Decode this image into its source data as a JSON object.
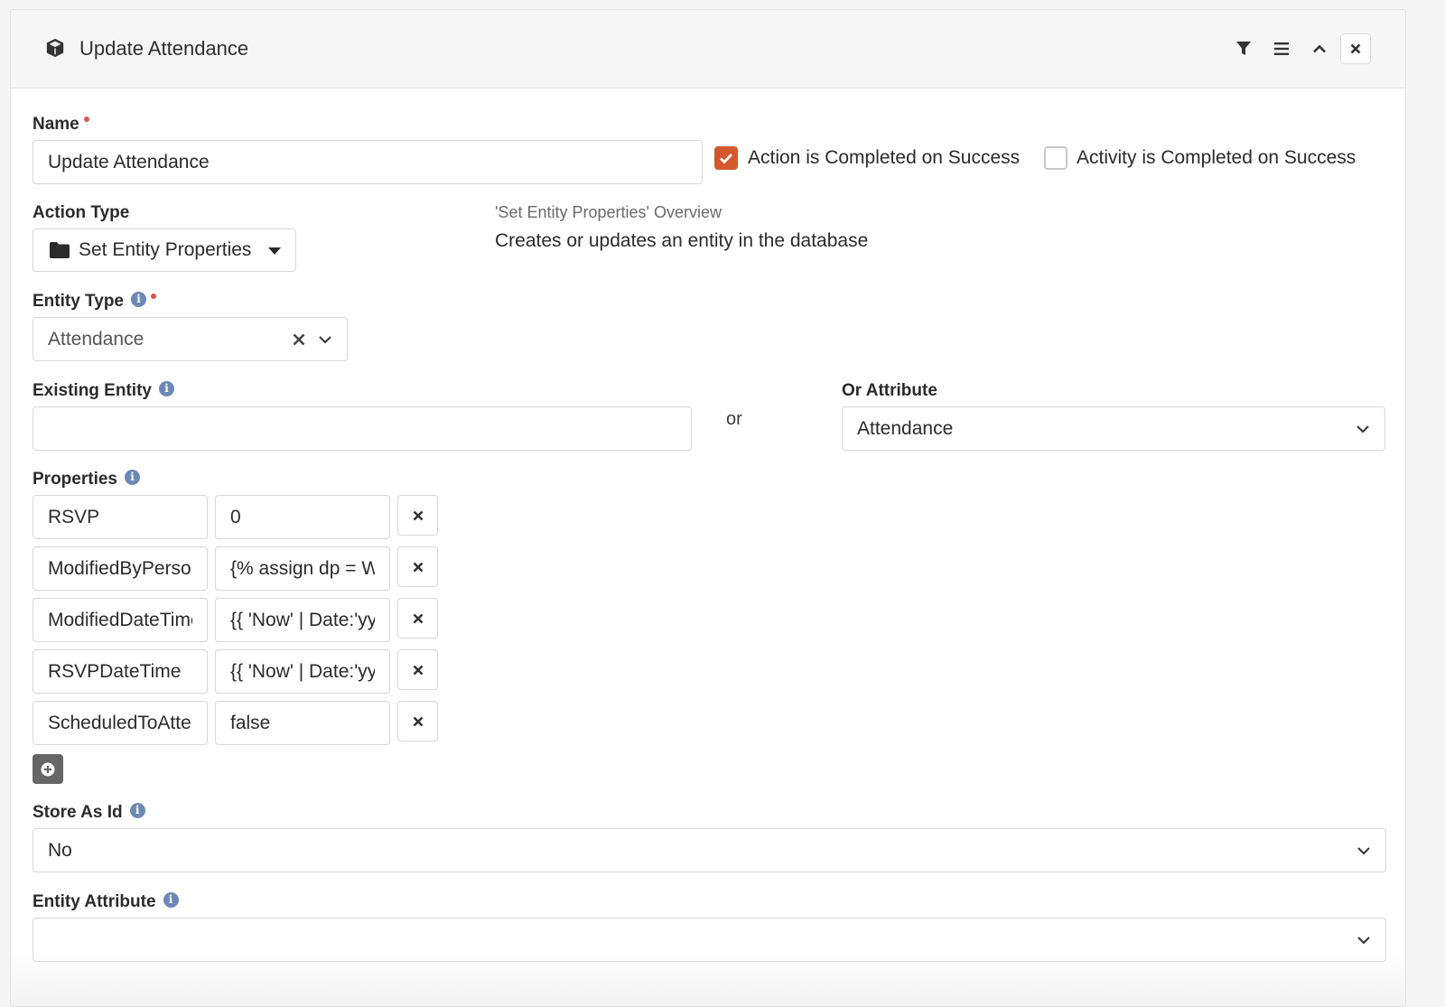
{
  "header": {
    "title": "Update Attendance",
    "icons": [
      "cube-icon",
      "filter-icon",
      "menu-icon",
      "chevron-up-icon",
      "close-icon"
    ]
  },
  "name": {
    "label": "Name",
    "required": true,
    "value": "Update Attendance"
  },
  "checkboxes": [
    {
      "label": "Action is Completed on Success",
      "checked": true
    },
    {
      "label": "Activity is Completed on Success",
      "checked": false
    }
  ],
  "action_type": {
    "label": "Action Type",
    "value": "Set Entity Properties",
    "icon": "folder-icon"
  },
  "overview": {
    "title": "'Set Entity Properties' Overview",
    "description": "Creates or updates an entity in the database"
  },
  "entity_type": {
    "label": "Entity Type",
    "required": true,
    "value": "Attendance"
  },
  "existing_entity": {
    "label": "Existing Entity",
    "value": ""
  },
  "or_text": "or",
  "or_attribute": {
    "label": "Or Attribute",
    "value": "Attendance"
  },
  "properties": {
    "label": "Properties",
    "rows": [
      {
        "key": "RSVP",
        "value": "0"
      },
      {
        "key": "ModifiedByPersonAliasId",
        "value": "{% assign dp = Workflow"
      },
      {
        "key": "ModifiedDateTime",
        "value": "{{ 'Now' | Date:'yyyy-MM-dd"
      },
      {
        "key": "RSVPDateTime",
        "value": "{{ 'Now' | Date:'yyyy-MM-dd"
      },
      {
        "key": "ScheduledToAttend",
        "value": "false"
      }
    ]
  },
  "store_as_id": {
    "label": "Store As Id",
    "value": "No"
  },
  "entity_attribute": {
    "label": "Entity Attribute",
    "value": ""
  },
  "colors": {
    "accent": "#d4582e",
    "info": "#6e88b6",
    "required": "#d9534f"
  }
}
